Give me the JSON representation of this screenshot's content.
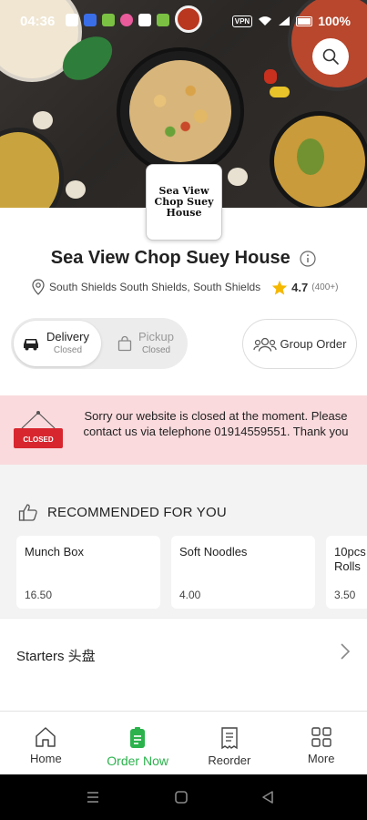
{
  "status_bar": {
    "time": "04:36",
    "vpn": "VPN",
    "battery": "100%"
  },
  "restaurant": {
    "logo_text": "Sea View Chop Suey House",
    "name": "Sea View Chop Suey House",
    "location": "South Shields South Shields, South Shields",
    "rating": "4.7",
    "rating_count": "(400+)"
  },
  "order_mode": {
    "delivery_label": "Delivery",
    "delivery_status": "Closed",
    "pickup_label": "Pickup",
    "pickup_status": "Closed",
    "group_order_label": "Group Order"
  },
  "closed_banner": {
    "sign_text": "CLOSED",
    "message": "Sorry our website is closed at the moment. Please contact us via telephone 01914559551. Thank you"
  },
  "recommended": {
    "heading": "RECOMMENDED FOR YOU",
    "items": [
      {
        "name": "Munch Box",
        "price": "16.50"
      },
      {
        "name": "Soft Noodles",
        "price": "4.00"
      },
      {
        "name": "10pcs Rolls",
        "price": "3.50"
      }
    ]
  },
  "categories": [
    {
      "label": "Starters 头盘"
    }
  ],
  "bottom_nav": {
    "items": [
      {
        "label": "Home",
        "icon": "home-icon"
      },
      {
        "label": "Order Now",
        "icon": "order-icon"
      },
      {
        "label": "Reorder",
        "icon": "receipt-icon"
      },
      {
        "label": "More",
        "icon": "grid-icon"
      }
    ],
    "active_color": "#2bb24c"
  },
  "colors": {
    "accent_green": "#2bb24c",
    "banner_bg": "#fadadd",
    "closed_sign": "#d8262e",
    "star": "#f5b800"
  }
}
